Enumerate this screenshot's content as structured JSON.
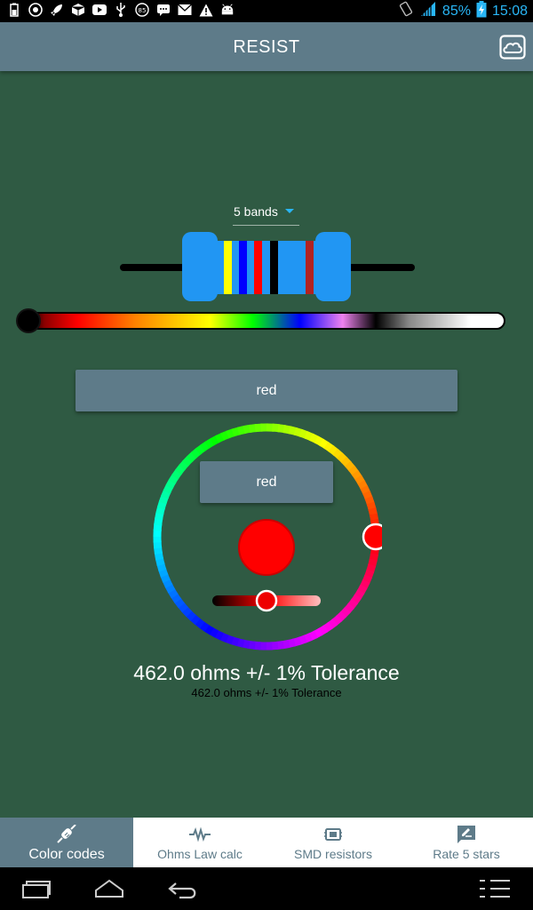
{
  "status_bar": {
    "battery_percent": "85%",
    "time": "15:08",
    "notification_icons": [
      "battery-small-icon",
      "app-icon",
      "rocket-icon",
      "box-icon",
      "youtube-icon",
      "usb-icon",
      "badge-85-icon",
      "chat-icon",
      "mail-icon",
      "warning-icon",
      "android-icon"
    ],
    "accent_color": "#29b6f6"
  },
  "app_bar": {
    "title": "RESIST",
    "action_icon": "cloud-icon",
    "color": "#5e7b89"
  },
  "band_selector": {
    "value": "5 bands"
  },
  "resistor": {
    "body_color": "#2196f3",
    "bands": [
      {
        "color": "#ffff00",
        "name": "yellow"
      },
      {
        "color": "#0000ff",
        "name": "blue"
      },
      {
        "color": "#ff0000",
        "name": "red"
      },
      {
        "color": "#000000",
        "name": "black"
      },
      {
        "color": "#b22222",
        "name": "brown-red"
      }
    ]
  },
  "spectrum_slider": {
    "value": 0
  },
  "color_button_1": {
    "label": "red"
  },
  "color_wheel": {
    "selected_label": "red",
    "preview_color": "#ff0000",
    "hue_degrees": 0,
    "brightness": 0.5
  },
  "result": {
    "main_text": "462.0 ohms +/- 1% Tolerance",
    "sub_text": "462.0 ohms +/- 1% Tolerance"
  },
  "bottom_nav": {
    "items": [
      {
        "label": "Color codes",
        "icon": "resistor-icon",
        "active": true
      },
      {
        "label": "Ohms Law calc",
        "icon": "zigzag-resistor-icon",
        "active": false
      },
      {
        "label": "SMD resistors",
        "icon": "chip-icon",
        "active": false
      },
      {
        "label": "Rate 5 stars",
        "icon": "rate-edit-icon",
        "active": false
      }
    ]
  },
  "system_nav": {
    "icons": [
      "recent-apps-icon",
      "home-icon",
      "back-icon",
      "menu-icon"
    ]
  }
}
